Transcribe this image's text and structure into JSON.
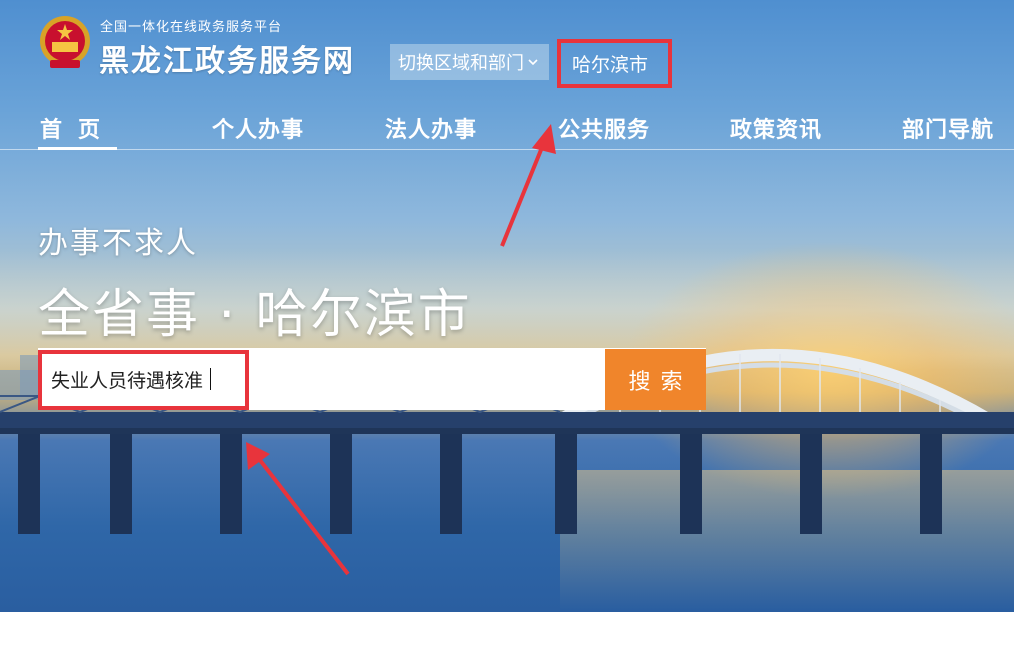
{
  "header": {
    "platform_label": "全国一体化在线政务服务平台",
    "site_title": "黑龙江政务服务网",
    "region_switch_label": "切换区域和部门",
    "current_city": "哈尔滨市",
    "emblem_icon": "national-emblem-icon"
  },
  "nav": {
    "items": [
      {
        "label": "首页",
        "active": true
      },
      {
        "label": "个人办事"
      },
      {
        "label": "法人办事"
      },
      {
        "label": "公共服务"
      },
      {
        "label": "政策资讯"
      },
      {
        "label": "部门导航"
      }
    ]
  },
  "hero": {
    "slogan": "办事不求人",
    "headline": "全省事 · 哈尔滨市"
  },
  "search": {
    "value": "失业人员待遇核准",
    "button_label": "搜索"
  },
  "colors": {
    "highlight_red": "#e8343c",
    "search_orange": "#f0852b",
    "sky_blue": "#4f8fd0"
  }
}
